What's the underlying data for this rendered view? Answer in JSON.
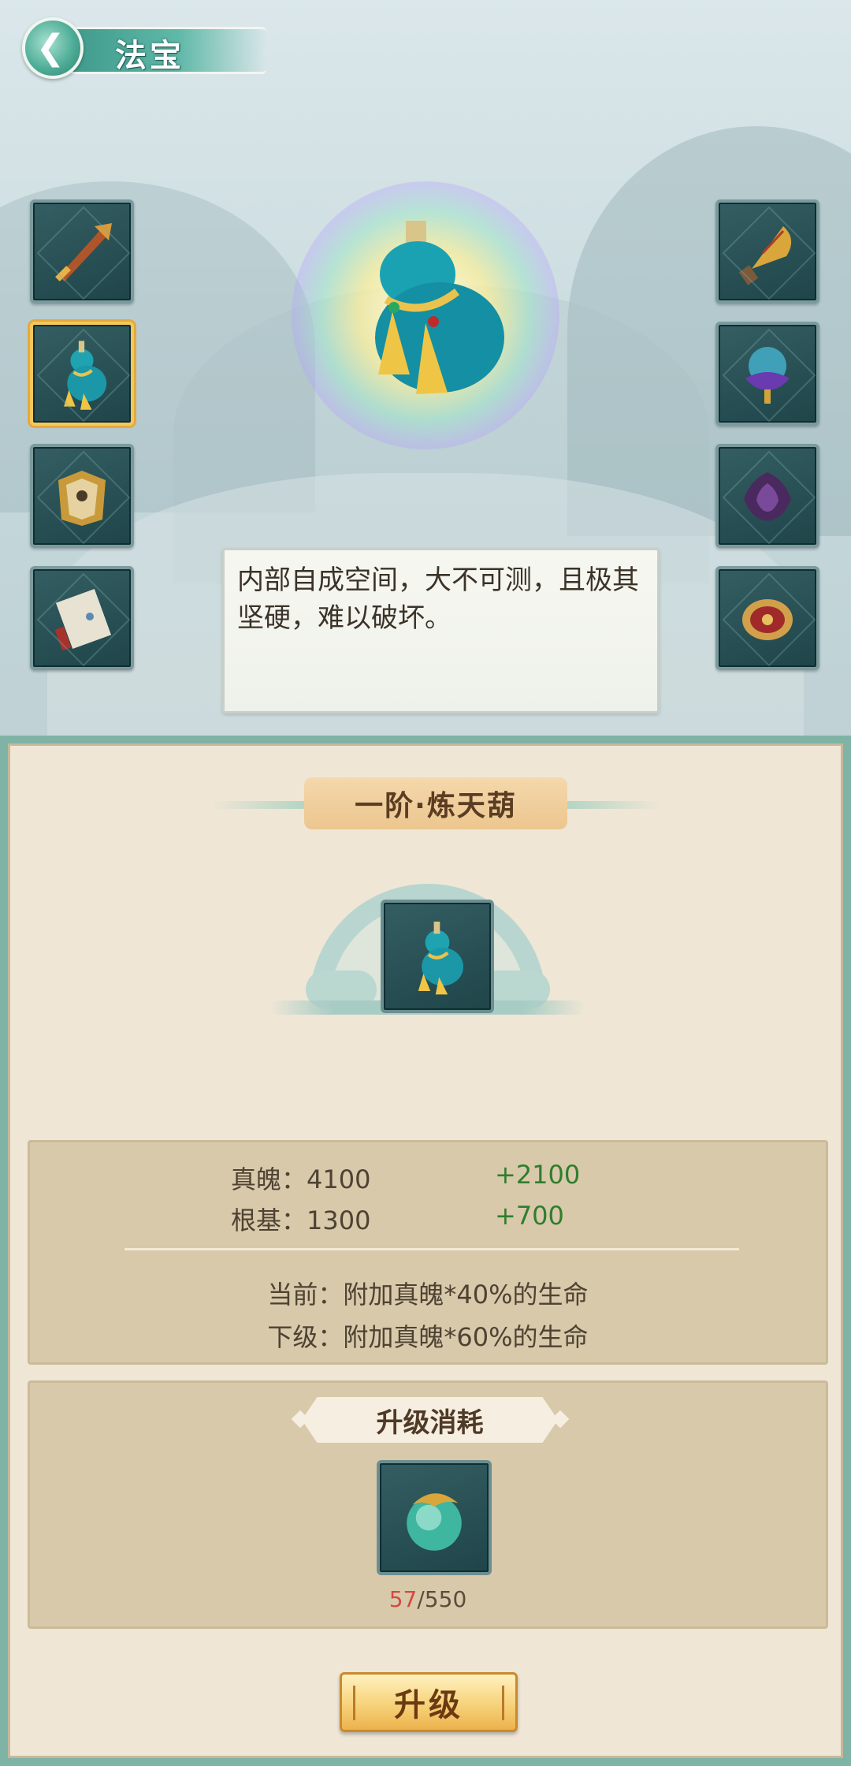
{
  "header": {
    "title": "法宝",
    "back_icon": "back-arrow-icon"
  },
  "left_slots": [
    {
      "name": "sword-treasure-icon"
    },
    {
      "name": "gourd-treasure-icon",
      "selected": true
    },
    {
      "name": "golden-armor-treasure-icon"
    },
    {
      "name": "scroll-treasure-icon"
    }
  ],
  "right_slots": [
    {
      "name": "fan-treasure-icon"
    },
    {
      "name": "jade-orb-treasure-icon"
    },
    {
      "name": "purple-lotus-treasure-icon"
    },
    {
      "name": "red-orb-treasure-icon"
    }
  ],
  "description": "内部自成空间，大不可测，且极其坚硬，难以破坏。",
  "item": {
    "name": "一阶·炼天葫"
  },
  "stats": [
    {
      "label": "真魄：4100",
      "bonus": "+2100"
    },
    {
      "label": "根基：1300",
      "bonus": "+700"
    }
  ],
  "effects": {
    "current": "当前：附加真魄*40%的生命",
    "next": "下级：附加真魄*60%的生命"
  },
  "cost": {
    "title": "升级消耗",
    "have": "57",
    "need": "/550",
    "material_icon": "spirit-orb-icon"
  },
  "upgrade_button": "升级",
  "colors": {
    "bonus": "#2f7e2d",
    "insufficient": "#d44a3f",
    "accent": "#5fb8a8"
  }
}
